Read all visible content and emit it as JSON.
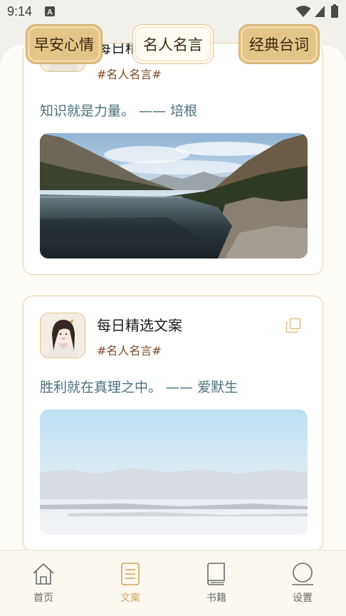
{
  "status_bar": {
    "time": "9:14"
  },
  "tabs": [
    {
      "label": "早安心情",
      "active": true
    },
    {
      "label": "名人名言",
      "active": false
    },
    {
      "label": "经典台词",
      "active": false
    }
  ],
  "cards": [
    {
      "author": "每日精选文案",
      "tag": "#名人名言#",
      "quote": "知识就是力量。 —— 培根",
      "photo_icon": "lake-mountain-photo"
    },
    {
      "author": "每日精选文案",
      "tag": "#名人名言#",
      "quote": "胜利就在真理之中。 —— 爱默生",
      "photo_icon": "snow-lake-photo"
    }
  ],
  "bottom_nav": [
    {
      "label": "首页",
      "icon": "home-icon",
      "active": false
    },
    {
      "label": "文案",
      "icon": "document-icon",
      "active": true
    },
    {
      "label": "书籍",
      "icon": "book-icon",
      "active": false
    },
    {
      "label": "设置",
      "icon": "settings-icon",
      "active": false
    }
  ],
  "colors": {
    "accent": "#e5c488",
    "active_nav": "#d3a55c",
    "inactive_nav": "#6a6a6a",
    "quote_text": "#4b7179",
    "tag_text": "#7a4b2c"
  }
}
